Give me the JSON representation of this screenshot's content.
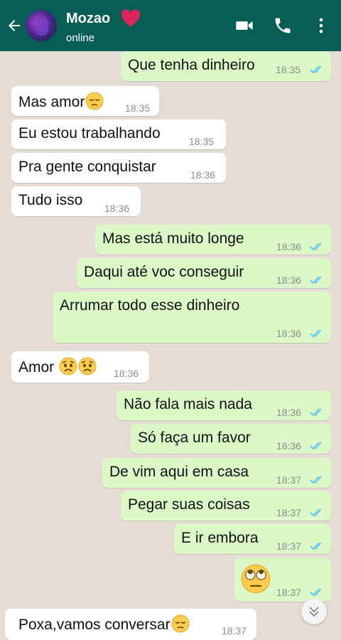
{
  "header": {
    "contact_name": "Mozao",
    "status": "online",
    "icons": [
      "back-arrow-icon",
      "heart-icon",
      "video-call-icon",
      "phone-icon",
      "more-options-icon"
    ],
    "color": "#075e54"
  },
  "colors": {
    "incoming_bubble": "#ffffff",
    "outgoing_bubble": "#dcf8c6",
    "read_ticks": "#4fc3f7",
    "chat_background": "#e5ddd5"
  },
  "messages": [
    {
      "direction": "out",
      "text": "Que tenha dinheiro",
      "time": "18:35",
      "read": true
    },
    {
      "direction": "in",
      "text": "Mas amor",
      "emoji": "pensive-face",
      "time": "18:35"
    },
    {
      "direction": "in",
      "text": "Eu estou trabalhando",
      "time": "18:35"
    },
    {
      "direction": "in",
      "text": "Pra gente conquistar",
      "time": "18:36"
    },
    {
      "direction": "in",
      "text": "Tudo isso",
      "time": "18:36"
    },
    {
      "direction": "out",
      "text": "Mas está muito longe",
      "time": "18:36",
      "read": true
    },
    {
      "direction": "out",
      "text": "Daqui até voc conseguir",
      "time": "18:36",
      "read": true
    },
    {
      "direction": "out",
      "text": "Arrumar todo esse dinheiro",
      "time": "18:36",
      "read": true
    },
    {
      "direction": "in",
      "text": "Amor",
      "emoji": "worried-face worried-face",
      "time": "18:36"
    },
    {
      "direction": "out",
      "text": "Não fala mais nada",
      "time": "18:36",
      "read": true
    },
    {
      "direction": "out",
      "text": "Só faça um favor",
      "time": "18:36",
      "read": true
    },
    {
      "direction": "out",
      "text": "De vim aqui em casa",
      "time": "18:37",
      "read": true
    },
    {
      "direction": "out",
      "text": "Pegar suas coisas",
      "time": "18:37",
      "read": true
    },
    {
      "direction": "out",
      "text": "E ir embora",
      "time": "18:37",
      "read": true
    },
    {
      "direction": "out",
      "text": "",
      "emoji": "eye-roll-face",
      "time": "18:37",
      "read": true
    },
    {
      "direction": "in",
      "text": "Poxa,vamos conversar",
      "emoji": "pensive-face",
      "time": "18:37"
    }
  ],
  "scroll_to_bottom_icon": "double-chevron-down-icon"
}
